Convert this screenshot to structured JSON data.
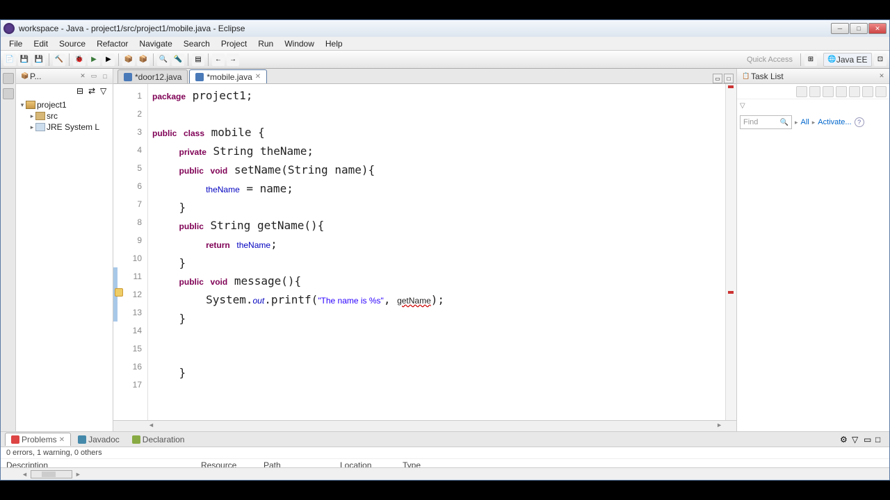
{
  "window": {
    "title": "workspace - Java - project1/src/project1/mobile.java - Eclipse"
  },
  "menu": [
    "File",
    "Edit",
    "Source",
    "Refactor",
    "Navigate",
    "Search",
    "Project",
    "Run",
    "Window",
    "Help"
  ],
  "quick_access": "Quick Access",
  "perspective": "Java EE",
  "package_explorer": {
    "title": "P...",
    "nodes": {
      "project": "project1",
      "src": "src",
      "jre": "JRE System L"
    }
  },
  "editor": {
    "tabs": [
      {
        "label": "*door12.java",
        "active": false
      },
      {
        "label": "*mobile.java",
        "active": true
      }
    ],
    "code_lines": {
      "1": {
        "plain": "package project1;"
      },
      "2": {
        "plain": ""
      },
      "3": {
        "plain": "public class mobile {"
      },
      "4": {
        "plain": "    private String theName;"
      },
      "5": {
        "plain": "    public void setName(String name){"
      },
      "6": {
        "plain": "        theName = name;"
      },
      "7": {
        "plain": "    }"
      },
      "8": {
        "plain": "    public String getName(){"
      },
      "9": {
        "plain": "        return theName;"
      },
      "10": {
        "plain": "    }"
      },
      "11": {
        "plain": "    public void message(){"
      },
      "12": {
        "plain": "        System.out.printf(\"The name is %s\", getName);"
      },
      "13": {
        "plain": "    }"
      },
      "14": {
        "plain": ""
      },
      "15": {
        "plain": ""
      },
      "16": {
        "plain": "    }"
      },
      "17": {
        "plain": ""
      }
    }
  },
  "tasklist": {
    "title": "Task List"
  },
  "find": {
    "placeholder": "Find",
    "all": "All",
    "activate": "Activate..."
  },
  "problems": {
    "tab_problems": "Problems",
    "tab_javadoc": "Javadoc",
    "tab_declaration": "Declaration",
    "status": "0 errors, 1 warning, 0 others",
    "cols": {
      "desc": "Description",
      "res": "Resource",
      "path": "Path",
      "loc": "Location",
      "type": "Type"
    }
  }
}
